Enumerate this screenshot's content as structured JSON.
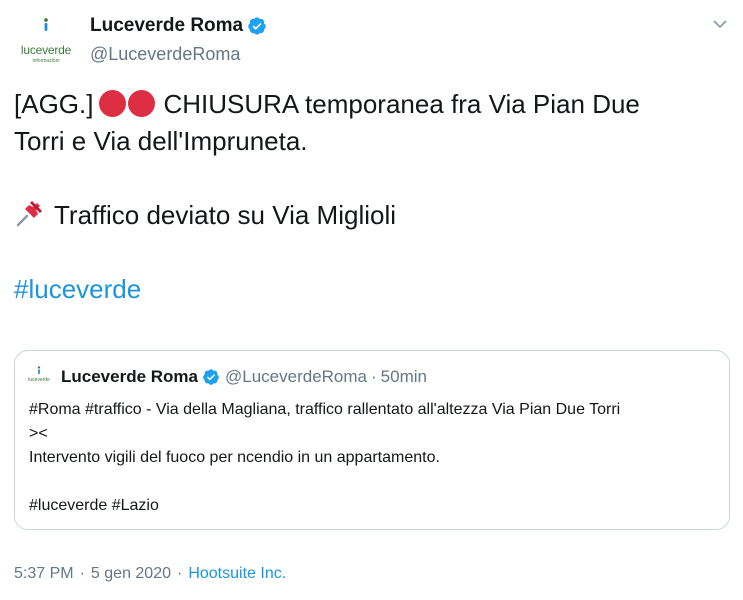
{
  "tweet": {
    "author": {
      "display_name": "Luceverde Roma",
      "handle": "@LuceverdeRoma",
      "avatar_brand": "luceverde",
      "avatar_brand_sub": "informazioni"
    },
    "body": {
      "line1_prefix": "[AGG.]",
      "line1_suffix": "CHIUSURA temporanea fra Via Pian Due",
      "line2": "Torri e Via dell'Impruneta.",
      "line3": "Traffico deviato su Via Miglioli",
      "hashtag": "#luceverde"
    },
    "icons": {
      "dot_color": "#dd2e44",
      "pin": "pushpin-icon"
    },
    "quoted": {
      "display_name": "Luceverde Roma",
      "handle": "@LuceverdeRoma",
      "separator": "·",
      "time": "50min",
      "line1": "#Roma #traffico - Via della Magliana, traffico rallentato all'altezza Via Pian Due Torri",
      "line2": "><",
      "line3": "Intervento vigili del fuoco per ncendio in un appartamento.",
      "line4": "#luceverde #Lazio"
    },
    "footer": {
      "time": "5:37 PM",
      "separator": "·",
      "date": "5 gen 2020",
      "source": "Hootsuite Inc."
    },
    "colors": {
      "link": "#1b95e0",
      "verified": "#1da1f2",
      "secondary_text": "#657786",
      "border": "#ccd6dd"
    }
  }
}
